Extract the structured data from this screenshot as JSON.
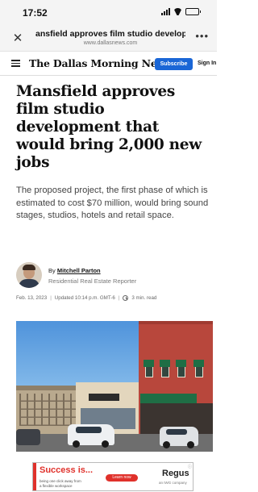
{
  "status_bar": {
    "time": "17:52",
    "battery_level": 0.7
  },
  "browser": {
    "page_title": "ansfield approves film studio develop",
    "url": "www.dallasnews.com",
    "close_icon": "close-icon",
    "more_icon": "more-icon"
  },
  "site_header": {
    "masthead": "The Dallas Morning News",
    "subscribe_label": "Subscribe",
    "signin_label": "Sign In"
  },
  "article": {
    "headline": "Mansfield approves film studio development that would bring 2,000 new jobs",
    "summary": "The proposed project, the first phase of which is estimated to cost $70 million, would bring sound stages, studios, hotels and retail space.",
    "byline_prefix": "By",
    "author_name": "Mitchell Parton",
    "author_role": "Residential Real Estate Reporter",
    "date": "Feb. 13, 2023",
    "updated": "Updated 10:14 p.m. GMT-6",
    "read_time": "3 min. read"
  },
  "ad": {
    "headline": "Success is...",
    "subline_1": "being one click away from",
    "subline_2": "a flexible workspace",
    "cta": "Learn now",
    "brand": "Regus",
    "brand_tag": "an IWG company"
  },
  "colors": {
    "accent_blue": "#1a66d6",
    "ad_red": "#e0312b"
  }
}
